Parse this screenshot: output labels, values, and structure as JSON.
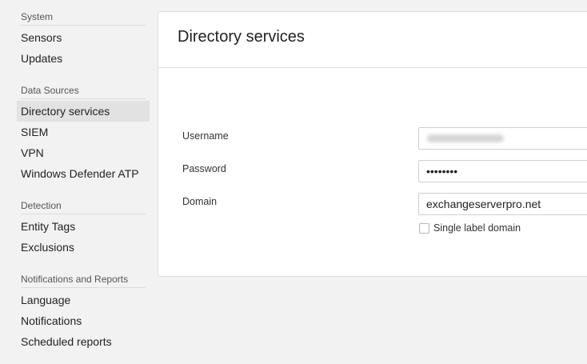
{
  "sidebar": {
    "sections": [
      {
        "title": "System",
        "items": [
          {
            "label": "Sensors"
          },
          {
            "label": "Updates"
          }
        ]
      },
      {
        "title": "Data Sources",
        "items": [
          {
            "label": "Directory services",
            "active": true
          },
          {
            "label": "SIEM"
          },
          {
            "label": "VPN"
          },
          {
            "label": "Windows Defender ATP"
          }
        ]
      },
      {
        "title": "Detection",
        "items": [
          {
            "label": "Entity Tags"
          },
          {
            "label": "Exclusions"
          }
        ]
      },
      {
        "title": "Notifications and Reports",
        "items": [
          {
            "label": "Language"
          },
          {
            "label": "Notifications"
          },
          {
            "label": "Scheduled reports"
          }
        ]
      }
    ]
  },
  "main": {
    "title": "Directory services",
    "form": {
      "username": {
        "label": "Username",
        "value": ""
      },
      "password": {
        "label": "Password",
        "value": "••••••••"
      },
      "domain": {
        "label": "Domain",
        "value": "exchangeserverpro.net"
      },
      "single_label_domain": {
        "label": "Single label domain",
        "checked": false
      }
    }
  },
  "colors": {
    "background": "#f2f2f2",
    "active_item": "#e2e2e2",
    "card": "#ffffff"
  }
}
